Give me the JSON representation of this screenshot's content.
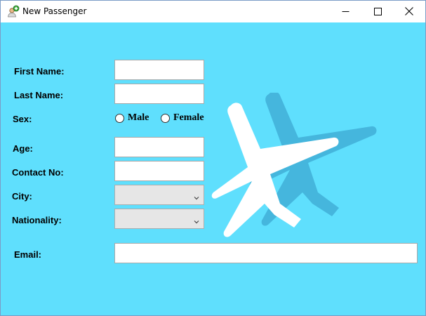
{
  "window": {
    "title": "New Passenger",
    "icon": "user-add-icon",
    "controls": [
      "minimize-icon",
      "maximize-icon",
      "close-icon"
    ]
  },
  "colors": {
    "background": "#5fdffd",
    "plane_front": "#ffffff",
    "plane_shadow": "#45b6dd"
  },
  "form": {
    "first_name_label": "First Name:",
    "first_name_value": "",
    "last_name_label": "Last Name:",
    "last_name_value": "",
    "sex_label": "Sex:",
    "sex_options": [
      "Male",
      "Female"
    ],
    "age_label": "Age:",
    "age_value": "",
    "contact_label": "Contact No:",
    "contact_value": "",
    "city_label": "City:",
    "city_value": "",
    "nationality_label": "Nationality:",
    "nationality_value": "",
    "email_label": "Email:",
    "email_value": ""
  },
  "decoration": {
    "image": "airplane-icon"
  }
}
